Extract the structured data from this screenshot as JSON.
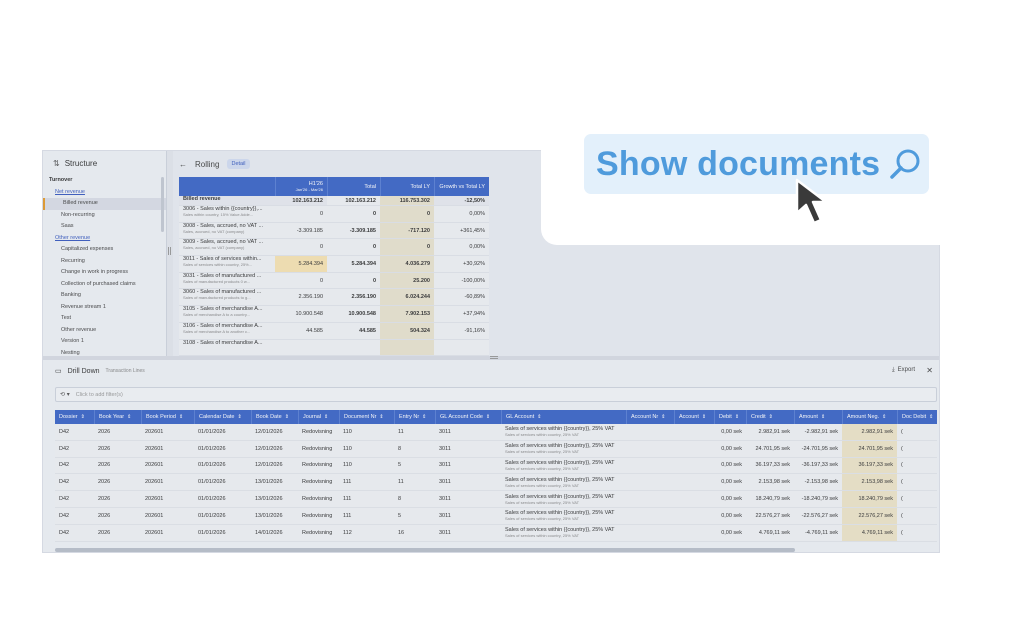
{
  "structure": {
    "title": "Structure",
    "items": [
      {
        "label": "Turnover",
        "level": 1
      },
      {
        "label": "Net revenue",
        "level": 2
      },
      {
        "label": "Billed revenue",
        "level": 3,
        "selected": true
      },
      {
        "label": "Non-recurring",
        "level": 3
      },
      {
        "label": "Saas",
        "level": 3
      },
      {
        "label": "Other revenue",
        "level": 2
      },
      {
        "label": "Capitalized expenses",
        "level": 3
      },
      {
        "label": "Recurring",
        "level": 3
      },
      {
        "label": "Change in work in progress",
        "level": 3
      },
      {
        "label": "Collection of purchased claims",
        "level": 3
      },
      {
        "label": "Banking",
        "level": 3
      },
      {
        "label": "Revenue stream 1",
        "level": 3
      },
      {
        "label": "Test",
        "level": 3
      },
      {
        "label": "Other revenue",
        "level": 3
      },
      {
        "label": "Version 1",
        "level": 3
      },
      {
        "label": "Nesting",
        "level": 3
      }
    ]
  },
  "rolling": {
    "title": "Rolling",
    "chip": "Detail",
    "headers": {
      "h1_main": "H1'26",
      "h1_sub": "Jan'26 - Mar'26",
      "total": "Total",
      "total_ly": "Total LY",
      "growth": "Growth vs Total LY"
    },
    "rows": [
      {
        "label": "Billed revenue",
        "sub": "",
        "h1": "102.163.212",
        "total": "102.163.212",
        "ly": "116.753.302",
        "growth": "-12,50%"
      },
      {
        "label": "3006 - Sales within {{country}},...",
        "sub": "Sales within country, 15% Value Adde...",
        "h1": "0",
        "total": "0",
        "ly": "0",
        "growth": "0,00%"
      },
      {
        "label": "3008 - Sales, accrued, no VAT ...",
        "sub": "Sales, accrued, no VAT (company)",
        "h1": "-3.309.185",
        "total": "-3.309.185",
        "ly": "-717.120",
        "growth": "+361,45%"
      },
      {
        "label": "3009 - Sales, accrued, no VAT ...",
        "sub": "Sales, accrued, no VAT (company)",
        "h1": "0",
        "total": "0",
        "ly": "0",
        "growth": "0,00%"
      },
      {
        "label": "3011 - Sales of services within...",
        "sub": "Sales of services within country, 25%...",
        "h1": "5.284.394",
        "total": "5.284.394",
        "ly": "4.036.279",
        "growth": "+30,92%",
        "highlight": true
      },
      {
        "label": "3031 - Sales of manufactured ...",
        "sub": "Sales of manufactured products 0 w...",
        "h1": "0",
        "total": "0",
        "ly": "25.200",
        "growth": "-100,00%"
      },
      {
        "label": "3060 - Sales of manufactured ...",
        "sub": "Sales of manufactured products to g...",
        "h1": "2.356.190",
        "total": "2.356.190",
        "ly": "6.024.244",
        "growth": "-60,89%"
      },
      {
        "label": "3105 - Sales of merchandise A...",
        "sub": "Sales of merchandise A to a country...",
        "h1": "10.900.548",
        "total": "10.900.548",
        "ly": "7.902.153",
        "growth": "+37,94%"
      },
      {
        "label": "3106 - Sales of merchandise A...",
        "sub": "Sales of merchandise A to another c...",
        "h1": "44.585",
        "total": "44.585",
        "ly": "504.324",
        "growth": "-91,16%"
      },
      {
        "label": "3108 - Sales of merchandise A...",
        "sub": "",
        "h1": "",
        "total": "",
        "ly": "",
        "growth": ""
      }
    ]
  },
  "drill": {
    "title": "Drill Down",
    "subtitle": "Transaction Lines",
    "export_label": "Export",
    "filter_placeholder": "Click to add filter(s)",
    "columns": [
      "Dossier",
      "Book Year",
      "Book Period",
      "Calendar Date",
      "Book Date",
      "Journal",
      "Document Nr",
      "Entry Nr",
      "GL Account Code",
      "GL Account",
      "Account Nr",
      "Account",
      "Debit",
      "Credit",
      "Amount",
      "Amount Neg.",
      "Doc Debit"
    ],
    "rows": [
      [
        "D42",
        "2026",
        "202601",
        "01/01/2026",
        "12/01/2026",
        "Redovisning",
        "110",
        "11",
        "3011",
        "Sales of services within {{country}}, 25% VAT",
        "",
        "",
        "0,00 sek",
        "2.982,91 sek",
        "-2.982,91 sek",
        "2.982,91 sek",
        "("
      ],
      [
        "D42",
        "2026",
        "202601",
        "01/01/2026",
        "12/01/2026",
        "Redovisning",
        "110",
        "8",
        "3011",
        "Sales of services within {{country}}, 25% VAT",
        "",
        "",
        "0,00 sek",
        "24.701,95 sek",
        "-24.701,95 sek",
        "24.701,95 sek",
        "("
      ],
      [
        "D42",
        "2026",
        "202601",
        "01/01/2026",
        "12/01/2026",
        "Redovisning",
        "110",
        "5",
        "3011",
        "Sales of services within {{country}}, 25% VAT",
        "",
        "",
        "0,00 sek",
        "36.197,33 sek",
        "-36.197,33 sek",
        "36.197,33 sek",
        "("
      ],
      [
        "D42",
        "2026",
        "202601",
        "01/01/2026",
        "13/01/2026",
        "Redovisning",
        "111",
        "11",
        "3011",
        "Sales of services within {{country}}, 25% VAT",
        "",
        "",
        "0,00 sek",
        "2.153,98 sek",
        "-2.153,98 sek",
        "2.153,98 sek",
        "("
      ],
      [
        "D42",
        "2026",
        "202601",
        "01/01/2026",
        "13/01/2026",
        "Redovisning",
        "111",
        "8",
        "3011",
        "Sales of services within {{country}}, 25% VAT",
        "",
        "",
        "0,00 sek",
        "18.240,79 sek",
        "-18.240,79 sek",
        "18.240,79 sek",
        "("
      ],
      [
        "D42",
        "2026",
        "202601",
        "01/01/2026",
        "13/01/2026",
        "Redovisning",
        "111",
        "5",
        "3011",
        "Sales of services within {{country}}, 25% VAT",
        "",
        "",
        "0,00 sek",
        "22.576,27 sek",
        "-22.576,27 sek",
        "22.576,27 sek",
        "("
      ],
      [
        "D42",
        "2026",
        "202601",
        "01/01/2026",
        "14/01/2026",
        "Redovisning",
        "112",
        "16",
        "3011",
        "Sales of services within {{country}}, 25% VAT",
        "",
        "",
        "0,00 sek",
        "4.769,11 sek",
        "-4.769,11 sek",
        "4.769,11 sek",
        "("
      ]
    ],
    "gl_sub": "Sales of services within country, 25% VAT"
  },
  "callout": {
    "label": "Show documents",
    "icon": "search-icon",
    "color": "#4f9bdc",
    "background": "#e3f0fb"
  },
  "colors": {
    "header_blue": "#3d66c7",
    "highlight": "#f6e2b2"
  }
}
